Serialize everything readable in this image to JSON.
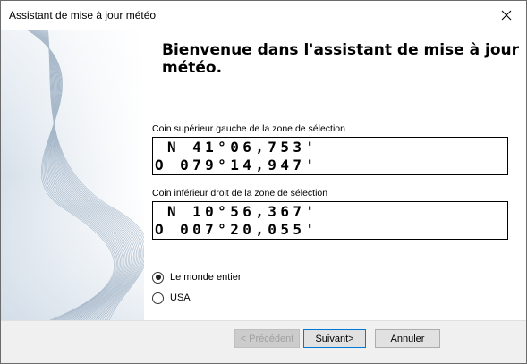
{
  "window": {
    "title": "Assistant de mise à jour météo"
  },
  "heading": "Bienvenue dans l'assistant de mise à jour météo.",
  "upper_left": {
    "label": "Coin supérieur gauche de la zone de sélection",
    "lat": " N 41°06,753'",
    "lon": "O 079°14,947'"
  },
  "lower_right": {
    "label": "Coin inférieur droit de la zone de sélection",
    "lat": " N 10°56,367'",
    "lon": "O 007°20,055'"
  },
  "options": [
    {
      "label": "Le monde entier",
      "checked": true
    },
    {
      "label": "USA",
      "checked": false
    }
  ],
  "buttons": {
    "previous": "< Précédent",
    "next": "Suivant>",
    "cancel": "Annuler"
  }
}
